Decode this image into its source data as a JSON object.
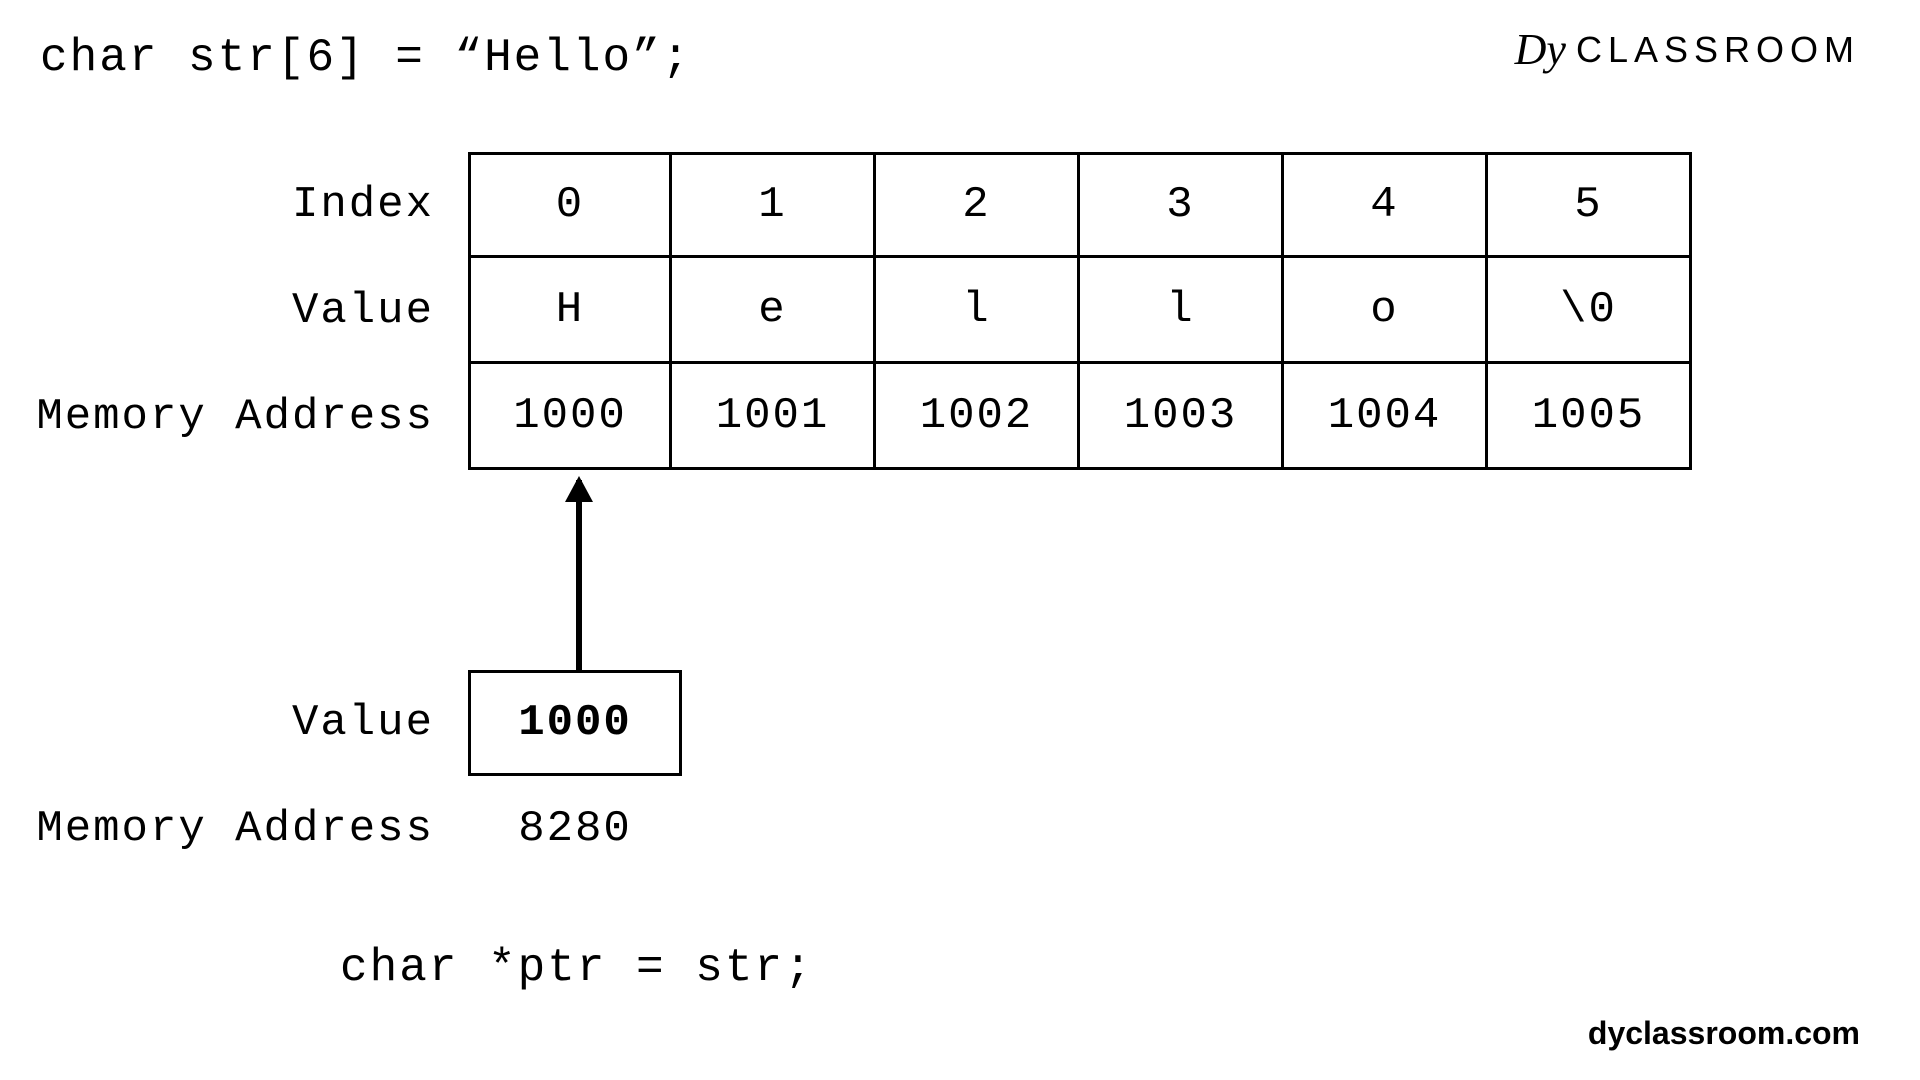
{
  "brand": {
    "icon_text": "Dy",
    "label": "CLASSROOM"
  },
  "site_url": "dyclassroom.com",
  "declaration": "char str[6] = “Hello”;",
  "table": {
    "row_labels": [
      "Index",
      "Value",
      "Memory Address"
    ],
    "columns": [
      {
        "index": "0",
        "value": "H",
        "addr": "1000"
      },
      {
        "index": "1",
        "value": "e",
        "addr": "1001"
      },
      {
        "index": "2",
        "value": "l",
        "addr": "1002"
      },
      {
        "index": "3",
        "value": "l",
        "addr": "1003"
      },
      {
        "index": "4",
        "value": "o",
        "addr": "1004"
      },
      {
        "index": "5",
        "value": "\\0",
        "addr": "1005"
      }
    ]
  },
  "pointer": {
    "value_label": "Value",
    "addr_label": "Memory Address",
    "value": "1000",
    "addr": "8280",
    "declaration": "char *ptr = str;"
  }
}
